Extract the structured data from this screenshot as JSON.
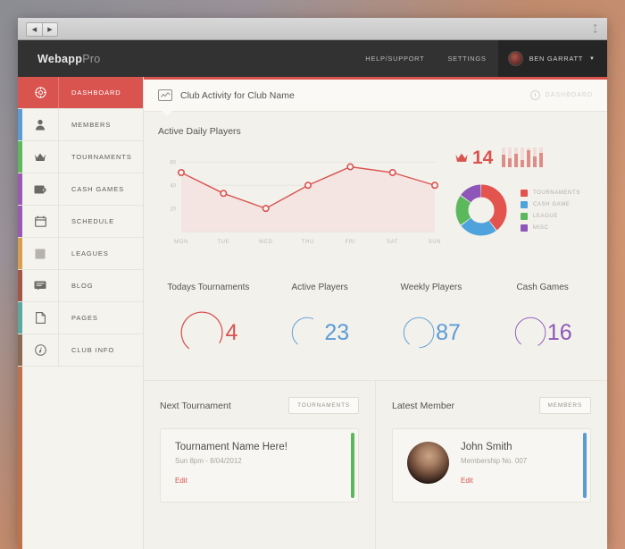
{
  "window": {
    "back_label": "◀",
    "forward_label": "▶",
    "resize_label": "⤢"
  },
  "topbar": {
    "brand_bold": "Webapp",
    "brand_light": "Pro",
    "links": [
      {
        "label": "HELP/SUPPORT"
      },
      {
        "label": "SETTINGS"
      }
    ],
    "user": {
      "name": "BEN GARRATT",
      "caret": "▼",
      "avatar_icon": "user-avatar"
    }
  },
  "sidebar": {
    "items": [
      {
        "label": "DASHBOARD",
        "icon": "dashboard-icon",
        "strip": "#d9534f",
        "active": true
      },
      {
        "label": "MEMBERS",
        "icon": "user-icon",
        "strip": "#5b9bd5",
        "active": false
      },
      {
        "label": "TOURNAMENTS",
        "icon": "crown-icon",
        "strip": "#5cb85c",
        "active": false
      },
      {
        "label": "CASH GAMES",
        "icon": "wallet-icon",
        "strip": "#9b59b6",
        "active": false
      },
      {
        "label": "SCHEDULE",
        "icon": "calendar-icon",
        "strip": "#9b59b6",
        "active": false
      },
      {
        "label": "LEAGUES",
        "icon": "square-icon",
        "strip": "#d99d4f",
        "active": false
      },
      {
        "label": "BLOG",
        "icon": "comment-icon",
        "strip": "#a35548",
        "active": false
      },
      {
        "label": "PAGES",
        "icon": "page-icon",
        "strip": "#5aa8a0",
        "active": false
      },
      {
        "label": "CLUB INFO",
        "icon": "info-icon",
        "strip": "#8a6a52",
        "active": false
      }
    ],
    "filler_strip": "#c0724c"
  },
  "page_header": {
    "icon": "line-chart-icon",
    "title": "Club Activity for Club Name",
    "breadcrumb_icon": "clock-icon",
    "breadcrumb_label": "DASHBOARD"
  },
  "chart_data": {
    "type": "line",
    "title": "Active Daily Players",
    "xlabel": "",
    "ylabel": "",
    "categories": [
      "MON",
      "TUE",
      "WED",
      "THU",
      "FRI",
      "SAT",
      "SUN"
    ],
    "values": [
      51,
      33,
      20,
      40,
      56,
      51,
      40
    ],
    "yticks": [
      20,
      40,
      60
    ],
    "ylim": [
      0,
      68
    ],
    "grid": true,
    "legend": "none",
    "line_color": "#d9534f",
    "fill_color": "#f4e3e1",
    "marker": "circle"
  },
  "secondary_charts": {
    "crown_stat": {
      "icon": "crown-icon",
      "value": "14",
      "color": "#d9534f"
    },
    "sparkline": {
      "type": "bar",
      "values": [
        62,
        45,
        70,
        38,
        86,
        55,
        74
      ],
      "bar_color": "#dd8d86",
      "track_color": "#f2dcd9"
    },
    "donut": {
      "type": "pie",
      "categories": [
        "TOURNAMENTS",
        "CASH GAME",
        "LEAGUE",
        "MISC"
      ],
      "values": [
        40,
        25,
        20,
        15
      ],
      "colors": [
        "#e3544f",
        "#4fa3dd",
        "#5cb85c",
        "#8e56b8"
      ]
    }
  },
  "kpis": [
    {
      "label": "Todays Tournaments",
      "value": "4",
      "color": "#d9534f",
      "percent": 72
    },
    {
      "label": "Active Players",
      "value": "23",
      "color": "#5b9bd5",
      "percent": 45
    },
    {
      "label": "Weekly Players",
      "value": "87",
      "color": "#5b9bd5",
      "percent": 88
    },
    {
      "label": "Cash Games",
      "value": "16",
      "color": "#8e56b8",
      "percent": 80
    }
  ],
  "panels": {
    "next_tournament": {
      "title": "Next Tournament",
      "button_label": "TOURNAMENTS",
      "item_title": "Tournament Name Here!",
      "item_sub": "Sun 8pm - 8/04/2012",
      "edit_label": "Edit",
      "accent_color": "#5cb85c"
    },
    "latest_member": {
      "title": "Latest Member",
      "button_label": "MEMBERS",
      "item_title": "John Smith",
      "item_sub": "Membership No. 007",
      "edit_label": "Edit",
      "accent_color": "#5b9bd5",
      "avatar_icon": "member-photo"
    }
  }
}
